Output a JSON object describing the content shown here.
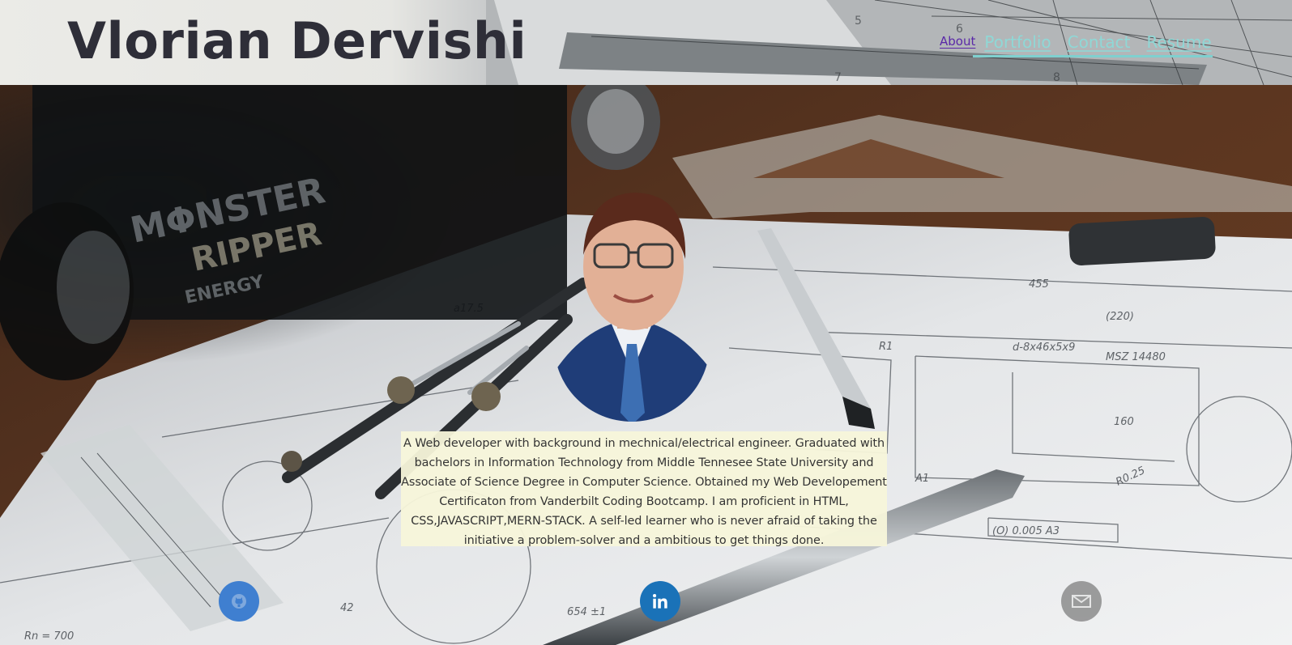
{
  "header": {
    "site_title": "Vlorian Dervishi"
  },
  "nav": {
    "items": [
      {
        "label": "About",
        "active": true
      },
      {
        "label": "Portfolio"
      },
      {
        "label": "Contact"
      },
      {
        "label": "Resume"
      }
    ]
  },
  "profile": {
    "bio": "A Web developer with background in mechnical/electrical engineer. Graduated with bachelors in Information Technology from Middle Tennesee State University and Associate of Science Degree in Computer Science. Obtained my Web Developement Certificaton from Vanderbilt Coding Bootcamp. I am proficient in HTML, CSS,JAVASCRIPT,MERN-STACK. A self-led learner who is never afraid of taking the initiative a problem-solver and a ambitious to get things done."
  },
  "social": [
    {
      "name": "github",
      "icon": "github-icon",
      "color": "#3f7fd0"
    },
    {
      "name": "linkedin",
      "icon": "linkedin-icon",
      "color": "#1a72b8"
    },
    {
      "name": "email",
      "icon": "envelope-icon",
      "color": "#7f7f7f"
    }
  ],
  "colors": {
    "accent": "#8fd8d6",
    "active_link": "#5a28a8",
    "title": "#2e2e38",
    "bio_background": "#f7f6da"
  }
}
